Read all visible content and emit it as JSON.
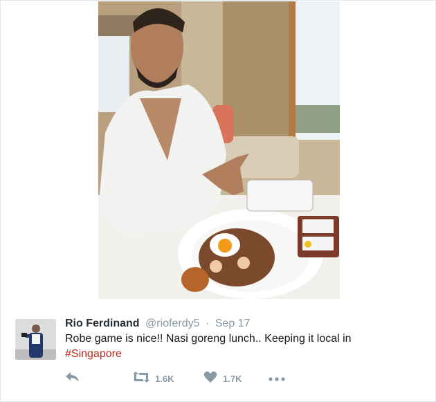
{
  "tweet": {
    "author_name": "Rio Ferdinand",
    "handle": "@rioferdy5",
    "separator": "·",
    "date": "Sep 17",
    "text": "Robe game is nice!! Nasi goreng lunch.. Keeping it local in",
    "hashtag": "#Singapore"
  },
  "actions": {
    "retweet_count": "1.6K",
    "like_count": "1.7K"
  },
  "colors": {
    "hashtag": "#c0281d",
    "muted": "#8899a6",
    "text": "#14171a"
  },
  "icons": [
    "reply-icon",
    "retweet-icon",
    "heart-icon",
    "more-icon"
  ]
}
